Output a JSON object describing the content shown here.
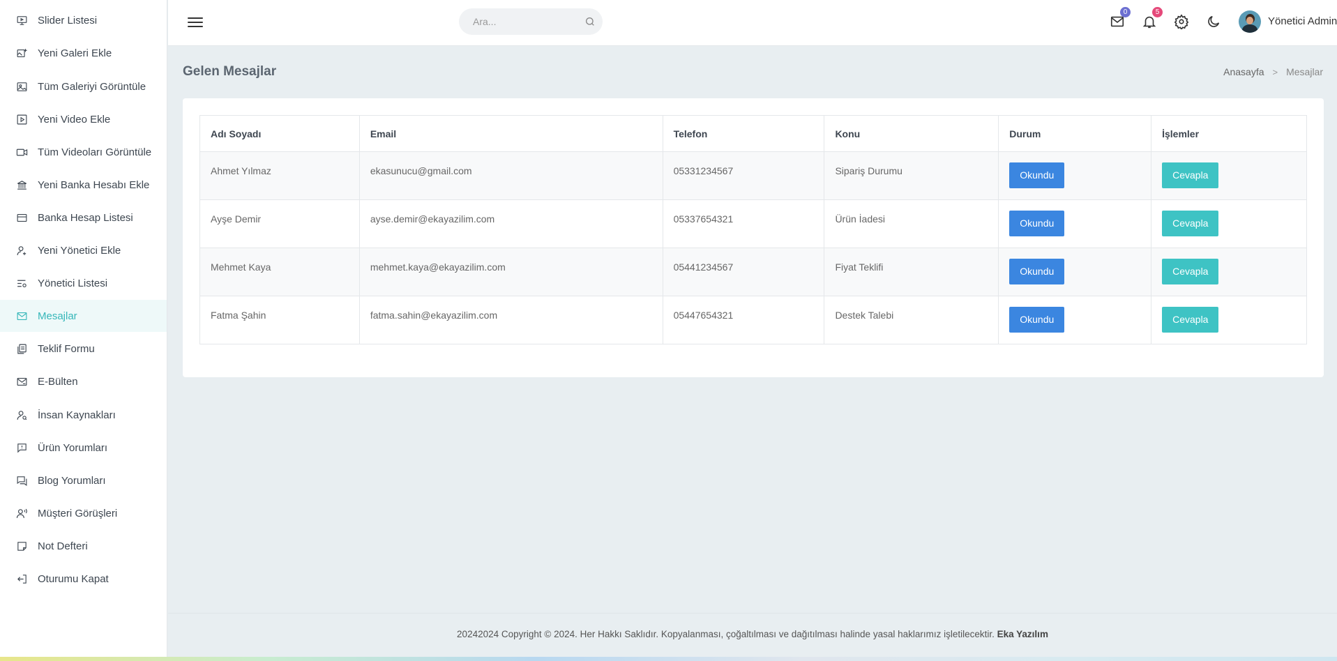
{
  "sidebar": {
    "items": [
      {
        "label": "Slider Listesi",
        "icon": "monitor-icon"
      },
      {
        "label": "Yeni Galeri Ekle",
        "icon": "gallery-add-icon"
      },
      {
        "label": "Tüm Galeriyi Görüntüle",
        "icon": "image-icon"
      },
      {
        "label": "Yeni Video Ekle",
        "icon": "video-play-icon"
      },
      {
        "label": "Tüm Videoları Görüntüle",
        "icon": "video-camera-icon"
      },
      {
        "label": "Yeni Banka Hesabı Ekle",
        "icon": "bank-icon"
      },
      {
        "label": "Banka Hesap Listesi",
        "icon": "credit-card-icon"
      },
      {
        "label": "Yeni Yönetici Ekle",
        "icon": "user-add-icon"
      },
      {
        "label": "Yönetici Listesi",
        "icon": "list-settings-icon"
      },
      {
        "label": "Mesajlar",
        "icon": "mail-icon",
        "active": true
      },
      {
        "label": "Teklif Formu",
        "icon": "file-copy-icon"
      },
      {
        "label": "E-Bülten",
        "icon": "mail-send-icon"
      },
      {
        "label": "İnsan Kaynakları",
        "icon": "user-search-icon"
      },
      {
        "label": "Ürün Yorumları",
        "icon": "comment-alert-icon"
      },
      {
        "label": "Blog Yorumları",
        "icon": "chat-icon"
      },
      {
        "label": "Müşteri Görüşleri",
        "icon": "user-voice-icon"
      },
      {
        "label": "Not Defteri",
        "icon": "sticky-note-icon"
      },
      {
        "label": "Oturumu Kapat",
        "icon": "logout-icon"
      }
    ]
  },
  "header": {
    "search_placeholder": "Ara...",
    "mail_count": "0",
    "notification_count": "5",
    "user_name": "Yönetici Admin"
  },
  "page": {
    "title": "Gelen Mesajlar",
    "breadcrumb_home": "Anasayfa",
    "breadcrumb_sep": ">",
    "breadcrumb_current": "Mesajlar"
  },
  "table": {
    "headers": [
      "Adı Soyadı",
      "Email",
      "Telefon",
      "Konu",
      "Durum",
      "İşlemler"
    ],
    "rows": [
      {
        "name": "Ahmet Yılmaz",
        "email": "ekasunucu@gmail.com",
        "phone": "05331234567",
        "subject": "Sipariş Durumu",
        "status": "Okundu",
        "action": "Cevapla"
      },
      {
        "name": "Ayşe Demir",
        "email": "ayse.demir@ekayazilim.com",
        "phone": "05337654321",
        "subject": "Ürün İadesi",
        "status": "Okundu",
        "action": "Cevapla"
      },
      {
        "name": "Mehmet Kaya",
        "email": "mehmet.kaya@ekayazilim.com",
        "phone": "05441234567",
        "subject": "Fiyat Teklifi",
        "status": "Okundu",
        "action": "Cevapla"
      },
      {
        "name": "Fatma Şahin",
        "email": "fatma.sahin@ekayazilim.com",
        "phone": "05447654321",
        "subject": "Destek Talebi",
        "status": "Okundu",
        "action": "Cevapla"
      }
    ]
  },
  "footer": {
    "text": "20242024 Copyright © 2024. Her Hakkı Saklıdır. Kopyalanması, çoğaltılması ve dağıtılması halinde yasal haklarımız işletilecektir.",
    "brand": "Eka Yazılım"
  },
  "colors": {
    "accent": "#36b7b9",
    "primary_button": "#3b86e0",
    "secondary_button": "#3ec3c4",
    "mail_badge": "#6c6fd1",
    "notification_badge": "#e5497a"
  }
}
